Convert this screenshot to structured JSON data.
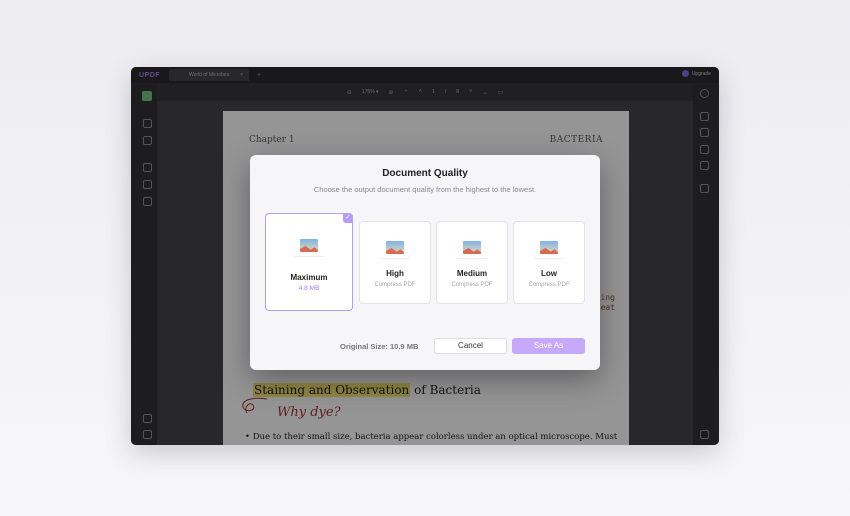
{
  "app": {
    "logo": "UPDF",
    "tab_title": "World of Microbes",
    "tab_close": "×",
    "tab_add": "+",
    "upgrade": "Upgrade"
  },
  "toolbar": {
    "zoom_out": "⊖",
    "zoom": "175% ▾",
    "zoom_in": "⊕",
    "page_current": "1",
    "page_sep": "/",
    "page_total": "8"
  },
  "document": {
    "chapter": "Chapter 1",
    "header_right": "BACTERIA",
    "margin_note_1": "ing",
    "margin_note_2": "eat",
    "heading_highlighted": "Staining and Observation",
    "heading_rest": " of Bacteria",
    "why_note": "Why dye?",
    "bullet_text": "Due to their small size, bacteria appear colorless under an optical microscope. Must"
  },
  "dialog": {
    "title": "Document Quality",
    "subtitle": "Choose the output document quality from the highest to the lowest.",
    "options": [
      {
        "name": "Maximum",
        "detail": "4.8 MB",
        "selected": true
      },
      {
        "name": "High",
        "detail": "Compress PDF",
        "selected": false
      },
      {
        "name": "Medium",
        "detail": "Compress PDF",
        "selected": false
      },
      {
        "name": "Low",
        "detail": "Compress PDF",
        "selected": false
      }
    ],
    "check": "✓",
    "original_size": "Original Size: 10.9 MB",
    "cancel": "Cancel",
    "save_as": "Save As"
  },
  "colors": {
    "accent": "#9b7cf6",
    "save_button": "#c7a9fa",
    "highlight": "#f6e36a"
  }
}
